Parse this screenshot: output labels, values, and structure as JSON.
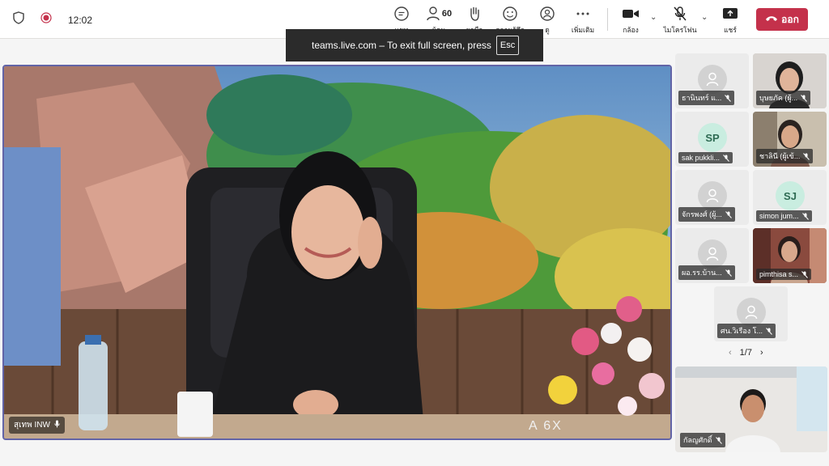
{
  "topbar": {
    "time": "12:02",
    "buttons": [
      {
        "label": "แชท",
        "icon": "chat-icon"
      },
      {
        "label": "ผู้คน",
        "icon": "people-icon",
        "count": "60"
      },
      {
        "label": "ยกมือ",
        "icon": "raise-hand-icon"
      },
      {
        "label": "ความรู้สึก",
        "icon": "reaction-icon"
      },
      {
        "label": "ดู",
        "icon": "view-icon"
      },
      {
        "label": "เพิ่มเติม",
        "icon": "more-icon"
      },
      {
        "label": "กล้อง",
        "icon": "camera-icon"
      },
      {
        "label": "ไมโครโฟน",
        "icon": "mic-off-icon"
      },
      {
        "label": "แชร์",
        "icon": "share-icon"
      }
    ],
    "leave_label": "ออก"
  },
  "fullscreen_banner": {
    "text": "teams.live.com – To exit full screen, press",
    "key": "Esc"
  },
  "main_video": {
    "name": "สุเทพ INW",
    "overlay_text": "A 6X"
  },
  "participants": [
    {
      "name": "ธานินทร์ แ...",
      "type": "avatar"
    },
    {
      "name": "บุษยภัค (ผู้...",
      "type": "video"
    },
    {
      "name": "sak pukkli...",
      "type": "initials",
      "initials": "SP"
    },
    {
      "name": "ชาลินี (ผู้เข้...",
      "type": "video"
    },
    {
      "name": "จักรพงศ์ (ผู้...",
      "type": "avatar"
    },
    {
      "name": "simon jum...",
      "type": "initials",
      "initials": "SJ"
    },
    {
      "name": "ผอ.รร.บ้าน...",
      "type": "avatar"
    },
    {
      "name": "pimthisa s...",
      "type": "video"
    },
    {
      "name": "ศน.วิเรือง โ...",
      "type": "avatar"
    }
  ],
  "pager": {
    "text": "1/7"
  },
  "self_view": {
    "name": "กัลญศักดิ์"
  }
}
